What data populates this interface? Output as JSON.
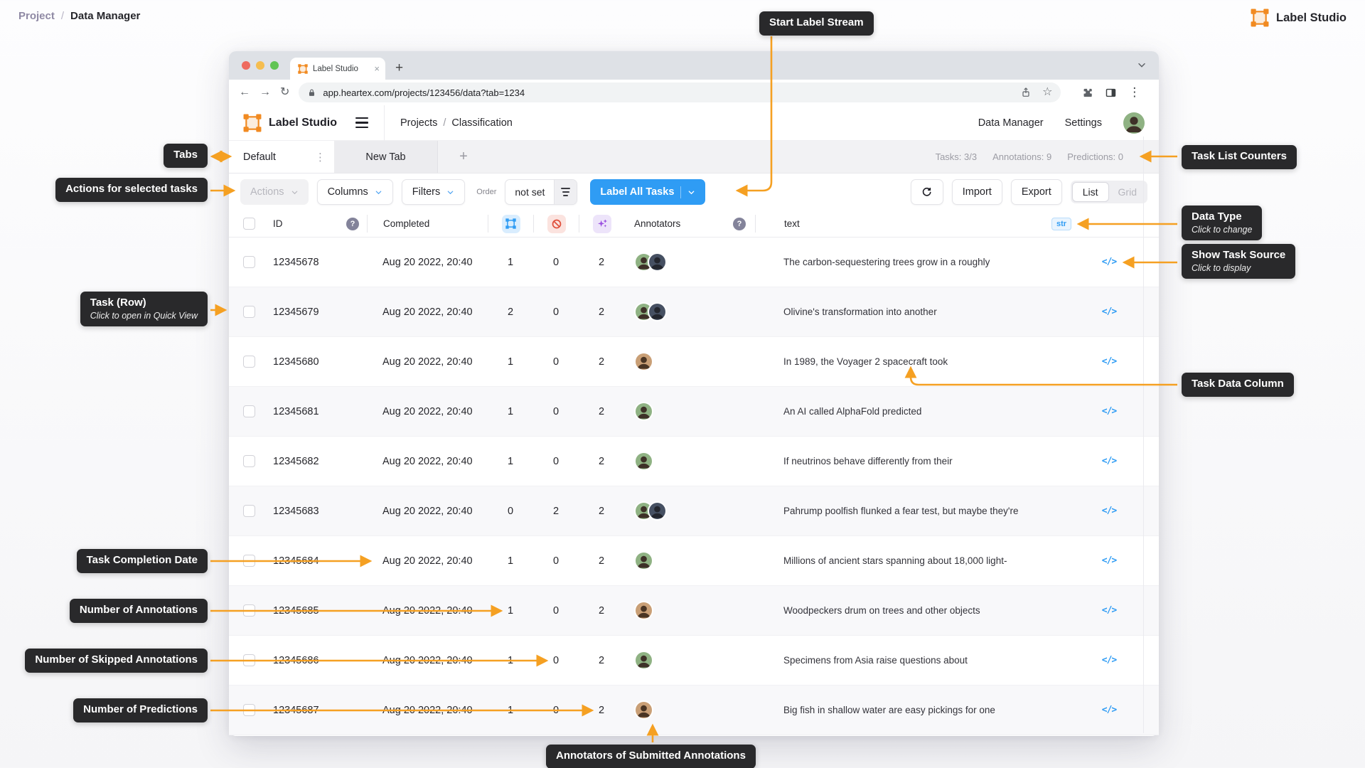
{
  "colors": {
    "accent_orange": "#F5A022",
    "primary_blue": "#2F9CF4",
    "callout_bg": "#29292B",
    "chip_red": "#E0503C",
    "chip_purple": "#9B51E0"
  },
  "page_breadcrumb": {
    "parent": "Project",
    "separator": "/",
    "current": "Data Manager"
  },
  "brand": {
    "name": "Label Studio"
  },
  "browser": {
    "tab_title": "Label Studio",
    "close_tab": "×",
    "new_tab": "+",
    "url": "app.heartex.com/projects/123456/data?tab=1234",
    "back": "←",
    "forward": "→",
    "reload": "↻",
    "star": "☆",
    "more": "⋮"
  },
  "header": {
    "brand": "Label Studio",
    "crumb_parent": "Projects",
    "crumb_sep": "/",
    "crumb_current": "Classification",
    "nav_data_manager": "Data Manager",
    "nav_settings": "Settings"
  },
  "tabs_bar": {
    "active_tab": "Default",
    "tab_menu": "⋮",
    "inactive_tab": "New Tab",
    "add_tab": "+",
    "counters": [
      "Tasks: 3/3",
      "Annotations: 9",
      "Predictions: 0"
    ]
  },
  "toolbar": {
    "actions": "Actions",
    "columns": "Columns",
    "filters": "Filters",
    "order_label": "Order",
    "order_value": "not set",
    "label_all_tasks": "Label All Tasks",
    "import": "Import",
    "export": "Export",
    "list": "List",
    "grid": "Grid"
  },
  "table": {
    "header": {
      "id": "ID",
      "help": "?",
      "completed": "Completed",
      "annotators": "Annotators",
      "help2": "?",
      "text": "text",
      "data_type": "str"
    },
    "source_icon": "</>",
    "rows": [
      {
        "id": "12345678",
        "completed": "Aug 20 2022, 20:40",
        "annotations": "1",
        "skipped": "0",
        "predictions": "2",
        "annotators": [
          "a1",
          "a2"
        ],
        "text": "The carbon-sequestering trees grow in a roughly"
      },
      {
        "id": "12345679",
        "completed": "Aug 20 2022, 20:40",
        "annotations": "2",
        "skipped": "0",
        "predictions": "2",
        "annotators": [
          "a1",
          "a2"
        ],
        "text": "Olivine's transformation into another"
      },
      {
        "id": "12345680",
        "completed": "Aug 20 2022, 20:40",
        "annotations": "1",
        "skipped": "0",
        "predictions": "2",
        "annotators": [
          "a3"
        ],
        "text": "In 1989, the Voyager 2 spacecraft took"
      },
      {
        "id": "12345681",
        "completed": "Aug 20 2022, 20:40",
        "annotations": "1",
        "skipped": "0",
        "predictions": "2",
        "annotators": [
          "a1"
        ],
        "text": "An AI called AlphaFold predicted"
      },
      {
        "id": "12345682",
        "completed": "Aug 20 2022, 20:40",
        "annotations": "1",
        "skipped": "0",
        "predictions": "2",
        "annotators": [
          "a1"
        ],
        "text": "If neutrinos behave differently from their"
      },
      {
        "id": "12345683",
        "completed": "Aug 20 2022, 20:40",
        "annotations": "0",
        "skipped": "2",
        "predictions": "2",
        "annotators": [
          "a1",
          "a2"
        ],
        "text": "Pahrump poolfish flunked a fear test, but maybe they're"
      },
      {
        "id": "12345684",
        "completed": "Aug 20 2022, 20:40",
        "annotations": "1",
        "skipped": "0",
        "predictions": "2",
        "annotators": [
          "a1"
        ],
        "text": "Millions of ancient stars spanning about 18,000 light-"
      },
      {
        "id": "12345685",
        "completed": "Aug 20 2022, 20:40",
        "annotations": "1",
        "skipped": "0",
        "predictions": "2",
        "annotators": [
          "a3"
        ],
        "text": "Woodpeckers drum on trees and other objects"
      },
      {
        "id": "12345686",
        "completed": "Aug 20 2022, 20:40",
        "annotations": "1",
        "skipped": "0",
        "predictions": "2",
        "annotators": [
          "a1"
        ],
        "text": "Specimens from Asia raise questions about"
      },
      {
        "id": "12345687",
        "completed": "Aug 20 2022, 20:40",
        "annotations": "1",
        "skipped": "0",
        "predictions": "2",
        "annotators": [
          "a3"
        ],
        "text": "Big fish in shallow water are easy pickings for one"
      }
    ]
  },
  "avatars": {
    "a1": {
      "bg": "#8FB283",
      "fg": "#3E3128"
    },
    "a2": {
      "bg": "#465062",
      "fg": "#23262E"
    },
    "a3": {
      "bg": "#C99F76",
      "fg": "#4A3524"
    }
  },
  "callouts": {
    "start_label_stream": {
      "title": "Start Label Stream"
    },
    "tabs": {
      "title": "Tabs"
    },
    "actions": {
      "title": "Actions for selected tasks"
    },
    "task_row": {
      "title": "Task (Row)",
      "subtitle": "Click to open in Quick View"
    },
    "completion_date": {
      "title": "Task Completion Date"
    },
    "num_annotations": {
      "title": "Number of Annotations"
    },
    "num_skipped": {
      "title": "Number of Skipped Annotations"
    },
    "num_predictions": {
      "title": "Number of Predictions"
    },
    "task_list_counters": {
      "title": "Task List Counters"
    },
    "data_type": {
      "title": "Data Type",
      "subtitle": "Click to change"
    },
    "show_task_source": {
      "title": "Show Task Source",
      "subtitle": "Click to display"
    },
    "task_data_column": {
      "title": "Task Data Column"
    },
    "annotators_submitted": {
      "title": "Annotators of Submitted Annotations"
    }
  }
}
